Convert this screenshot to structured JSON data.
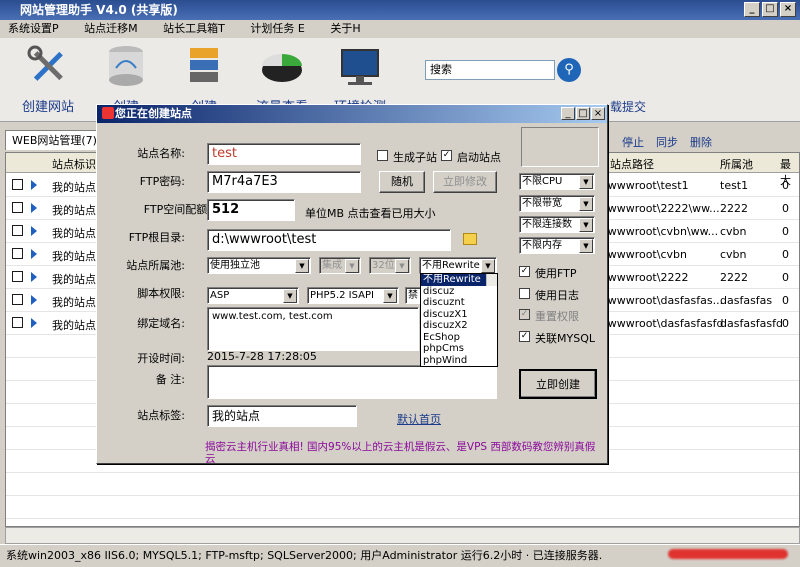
{
  "app": {
    "title": "网站管理助手 V4.0 (共享版)",
    "min": "_",
    "max": "□",
    "close": "×"
  },
  "menu": [
    "系统设置P",
    "站点迁移M",
    "站长工具箱T",
    "计划任务 E",
    "关于H"
  ],
  "toolbar": [
    {
      "label": "创建网站",
      "icon": "wrench-icon"
    },
    {
      "label": "创建",
      "icon": "database-icon"
    },
    {
      "label": "创建",
      "icon": "server-icon"
    },
    {
      "label": "流量查看",
      "icon": "pie-chart-icon"
    },
    {
      "label": "环境检测",
      "icon": "monitor-icon"
    }
  ],
  "search": {
    "value": "搜索"
  },
  "toolbar_extra": "载提交",
  "tab": "WEB网站管理(7)",
  "right_links": [
    "停止",
    "同步",
    "删除"
  ],
  "grid": {
    "headers": {
      "id": "站点标识",
      "path": "站点路径",
      "pool": "所属池",
      "max": "最大"
    },
    "rows": [
      {
        "name": "我的站点",
        "path": "\\wwwroot\\test1",
        "pool": "test1",
        "max": "0"
      },
      {
        "name": "我的站点",
        "path": "\\wwwroot\\2222\\ww...",
        "pool": "2222",
        "max": "0"
      },
      {
        "name": "我的站点",
        "path": "\\wwwroot\\cvbn\\ww...",
        "pool": "cvbn",
        "max": "0"
      },
      {
        "name": "我的站点",
        "path": "\\wwwroot\\cvbn",
        "pool": "cvbn",
        "max": "0"
      },
      {
        "name": "我的站点",
        "path": "\\wwwroot\\2222",
        "pool": "2222",
        "max": "0"
      },
      {
        "name": "我的站点",
        "path": "\\wwwroot\\dasfasfas...",
        "pool": "dasfasfas",
        "max": "0"
      },
      {
        "name": "我的站点",
        "path": "\\wwwroot\\dasfasfasfd",
        "pool": "dasfasfasfd",
        "max": "0"
      }
    ]
  },
  "status": "系统win2003_x86 IIS6.0; MYSQL5.1; FTP-msftp; SQLServer2000; 用户Administrator 运行6.2小时 · 已连接服务器.",
  "dialog": {
    "title": "您正在创建站点",
    "site_name_label": "站点名称:",
    "site_name": "test",
    "sub_site": "生成子站",
    "start_site": "启动站点",
    "ftp_pwd_label": "FTP密码:",
    "ftp_pwd": "M7r4a7E3",
    "random_btn": "随机",
    "modify_btn": "立即修改",
    "ftp_quota_label": "FTP空间配额:",
    "ftp_quota": "512",
    "quota_note": "单位MB 点击查看已用大小",
    "ftp_root_label": "FTP根目录:",
    "ftp_root": "d:\\wwwroot\\test",
    "pool_label": "站点所属池:",
    "pool": "使用独立池",
    "pipeline": "集成",
    "bits": "32位",
    "rewrite": "不用Rewrite",
    "script_label": "脚本权限:",
    "script": "ASP",
    "php": "PHP5.2 ISAPI",
    "php_extra": "禁",
    "domain_label": "绑定域名:",
    "domains": "www.test.com, test.com",
    "time_label": "开设时间:",
    "time": "2015-7-28 17:28:05",
    "note_label": "备  注:",
    "tag_label": "站点标签:",
    "tag": "我的站点",
    "default_page": "默认首页",
    "ad": "揭密云主机行业真相! 国内95%以上的云主机是假云、是VPS 西部数码教您辨别真假云",
    "rewrite_options": [
      "不用Rewrite",
      "discuz",
      "discuznt",
      "discuzX1",
      "discuzX2",
      "EcShop",
      "phpCms",
      "phpWind"
    ],
    "limits": [
      "不限CPU",
      "不限带宽",
      "不限连接数",
      "不限内存"
    ],
    "use_ftp": "使用FTP",
    "use_log": "使用日志",
    "reset_perm": "重置权限",
    "link_mysql": "关联MYSQL",
    "create_btn": "立即创建"
  }
}
